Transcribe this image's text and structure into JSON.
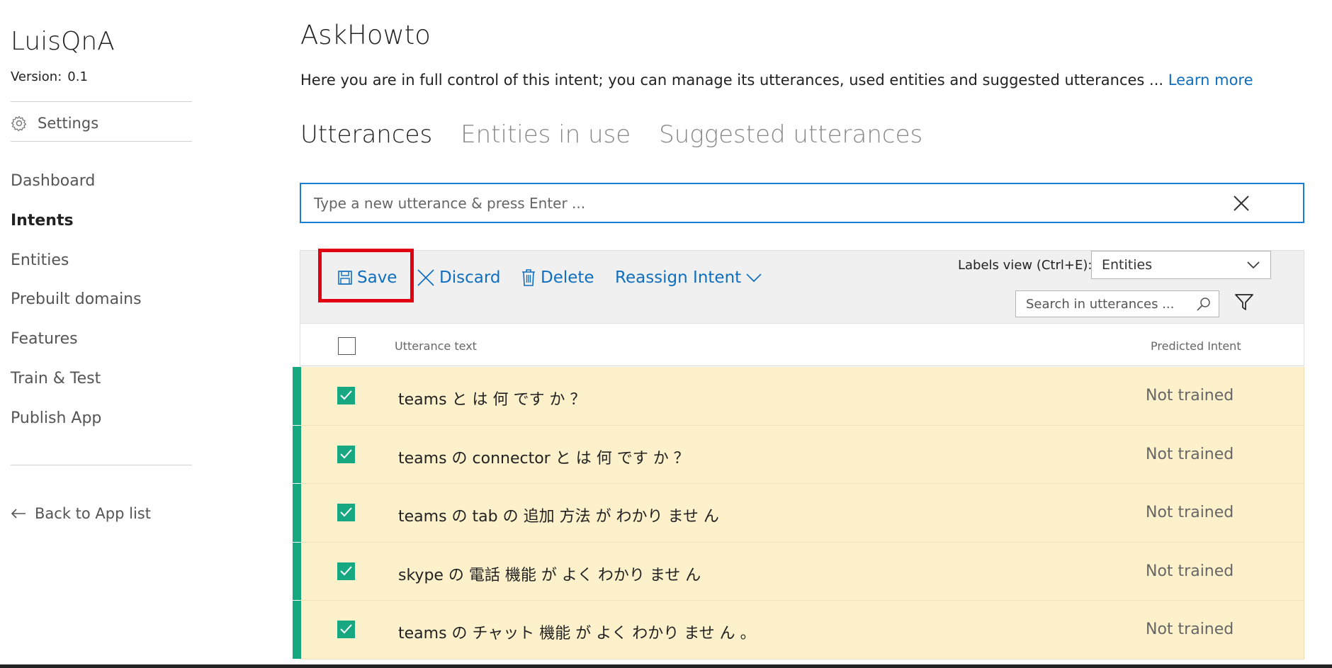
{
  "sidebar": {
    "app_name": "LuisQnA",
    "version_label": "Version:",
    "version_value": "0.1",
    "settings_label": "Settings",
    "nav": [
      {
        "label": "Dashboard",
        "active": false
      },
      {
        "label": "Intents",
        "active": true
      },
      {
        "label": "Entities",
        "active": false
      },
      {
        "label": "Prebuilt domains",
        "active": false
      },
      {
        "label": "Features",
        "active": false
      },
      {
        "label": "Train & Test",
        "active": false
      },
      {
        "label": "Publish App",
        "active": false
      }
    ],
    "back_label": "Back to App list"
  },
  "main": {
    "title": "AskHowto",
    "description": "Here you are in full control of this intent; you can manage its utterances, used entities and suggested utterances ... ",
    "learn_more": "Learn more",
    "tabs": [
      {
        "label": "Utterances",
        "active": true
      },
      {
        "label": "Entities in use",
        "active": false
      },
      {
        "label": "Suggested utterances",
        "active": false
      }
    ],
    "utterance_input": {
      "placeholder": "Type a new utterance & press Enter ...",
      "value": ""
    }
  },
  "toolbar": {
    "save": "Save",
    "discard": "Discard",
    "delete": "Delete",
    "reassign": "Reassign Intent",
    "labels_view_label": "Labels view (Ctrl+E):",
    "labels_view_value": "Entities",
    "search_placeholder": "Search in utterances ..."
  },
  "table": {
    "columns": {
      "text": "Utterance text",
      "predicted": "Predicted Intent"
    },
    "rows": [
      {
        "text": "teams と は 何 です か ？",
        "predicted": "Not trained",
        "checked": true
      },
      {
        "text": "teams の connector と は 何 です か ？",
        "predicted": "Not trained",
        "checked": true
      },
      {
        "text": "teams の tab の 追加 方法 が わかり ませ ん",
        "predicted": "Not trained",
        "checked": true
      },
      {
        "text": "skype の 電話 機能 が よく わかり ませ ん",
        "predicted": "Not trained",
        "checked": true
      },
      {
        "text": "teams の チャット 機能 が よく わかり ませ ん 。",
        "predicted": "Not trained",
        "checked": true
      }
    ]
  },
  "colors": {
    "accent_blue": "#106ebe",
    "row_highlight": "#fdf1cb",
    "check_green": "#17a882",
    "annotation_red": "#e00012"
  }
}
